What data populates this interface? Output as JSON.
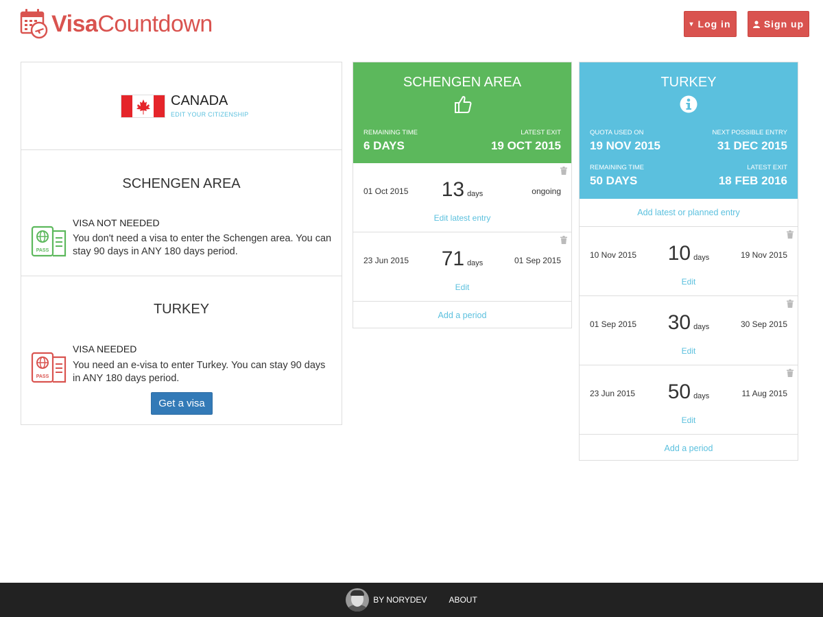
{
  "header": {
    "logo_bold": "Visa",
    "logo_rest": "Countdown",
    "login_label": "Log in",
    "signup_label": "Sign up",
    "brand_color": "#d9534f"
  },
  "citizenship": {
    "country": "CANADA",
    "edit_label": "EDIT YOUR CITIZENSHIP",
    "flag_icon": "canada-flag"
  },
  "requirements": [
    {
      "zone": "SCHENGEN AREA",
      "status": "VISA NOT NEEDED",
      "text": "You don't need a visa to enter the Schengen area. You can stay 90 days in ANY 180 days period.",
      "icon": "passport-icon",
      "color": "#5cb85c"
    },
    {
      "zone": "TURKEY",
      "status": "VISA NEEDED",
      "text": "You need an e-visa to enter Turkey. You can stay 90 days in ANY 180 days period.",
      "icon": "passport-icon",
      "color": "#d9534f",
      "action_label": "Get a visa"
    }
  ],
  "schengen": {
    "title": "SCHENGEN AREA",
    "icon": "thumbs-up-icon",
    "color": "#5cb85c",
    "remaining_label": "REMAINING TIME",
    "remaining_value": "6 DAYS",
    "exit_label": "LATEST EXIT",
    "exit_value": "19 OCT 2015",
    "entries": [
      {
        "start": "01 Oct 2015",
        "days": "13",
        "unit": "days",
        "end": "ongoing",
        "edit": "Edit latest entry"
      },
      {
        "start": "23 Jun 2015",
        "days": "71",
        "unit": "days",
        "end": "01 Sep 2015",
        "edit": "Edit"
      }
    ],
    "add_label": "Add a period"
  },
  "turkey": {
    "title": "TURKEY",
    "icon": "info-icon",
    "color": "#5bc0de",
    "quota_label": "QUOTA USED ON",
    "quota_value": "19 NOV 2015",
    "next_label": "NEXT POSSIBLE ENTRY",
    "next_value": "31 DEC 2015",
    "remaining_label": "REMAINING TIME",
    "remaining_value": "50 DAYS",
    "exit_label": "LATEST EXIT",
    "exit_value": "18 FEB 2016",
    "add_entry_label": "Add latest or planned entry",
    "entries": [
      {
        "start": "10 Nov 2015",
        "days": "10",
        "unit": "days",
        "end": "19 Nov 2015",
        "edit": "Edit"
      },
      {
        "start": "01 Sep 2015",
        "days": "30",
        "unit": "days",
        "end": "30 Sep 2015",
        "edit": "Edit"
      },
      {
        "start": "23 Jun 2015",
        "days": "50",
        "unit": "days",
        "end": "11 Aug 2015",
        "edit": "Edit"
      }
    ],
    "add_label": "Add a period"
  },
  "footer": {
    "by_label": "BY NORYDEV",
    "about_label": "ABOUT"
  }
}
